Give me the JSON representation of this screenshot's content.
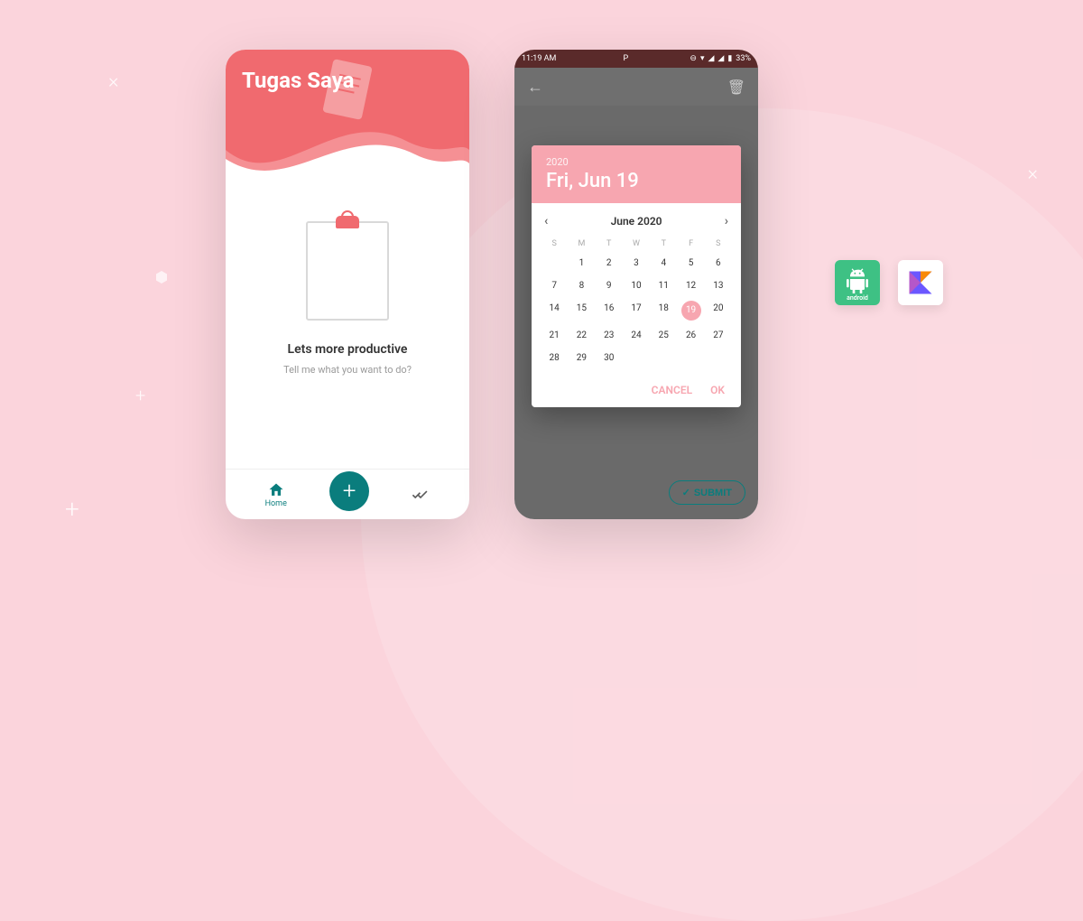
{
  "phone1": {
    "title": "Tugas Saya",
    "empty_heading": "Lets more productive",
    "empty_sub": "Tell me what you want to do?",
    "nav": {
      "home": "Home"
    }
  },
  "phone2": {
    "status": {
      "time": "11:19 AM",
      "battery": "33%"
    },
    "submit": "SUBMIT",
    "picker": {
      "year": "2020",
      "selected_date": "Fri, Jun 19",
      "month_label": "June 2020",
      "selected_day": 19,
      "cancel": "CANCEL",
      "ok": "OK",
      "dow": [
        "S",
        "M",
        "T",
        "W",
        "T",
        "F",
        "S"
      ],
      "days": [
        null,
        1,
        2,
        3,
        4,
        5,
        6,
        7,
        8,
        9,
        10,
        11,
        12,
        13,
        14,
        15,
        16,
        17,
        18,
        19,
        20,
        21,
        22,
        23,
        24,
        25,
        26,
        27,
        28,
        29,
        30,
        null,
        null,
        null,
        null
      ]
    }
  },
  "badges": {
    "android": "android"
  }
}
